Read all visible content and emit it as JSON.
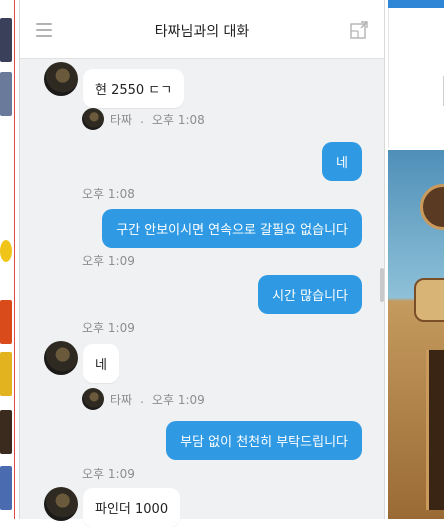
{
  "chat": {
    "title": "타짜님과의 대화"
  },
  "messages": [
    {
      "type": "in",
      "text": "현 2550 ㄷㄱ"
    },
    {
      "type": "sender",
      "name": "타짜",
      "time": "오후 1:08"
    },
    {
      "type": "out",
      "text": "네",
      "time": "오후 1:08"
    },
    {
      "type": "out",
      "text": "구간 안보이시면 연속으로 갈필요 없습니다",
      "time": "오후 1:09"
    },
    {
      "type": "out",
      "text": "시간 많습니다",
      "time": "오후 1:09"
    },
    {
      "type": "in",
      "text": "네"
    },
    {
      "type": "sender",
      "name": "타짜",
      "time": "오후 1:09"
    },
    {
      "type": "out",
      "text": "부담 없이 천천히 부탁드립니다",
      "time": "오후 1:09"
    },
    {
      "type": "in",
      "text": "파인더 1000"
    }
  ],
  "colors": {
    "outgoing_bubble": "#2f9ae3",
    "incoming_bubble": "#ffffff",
    "chat_background": "#f0f1f3"
  }
}
